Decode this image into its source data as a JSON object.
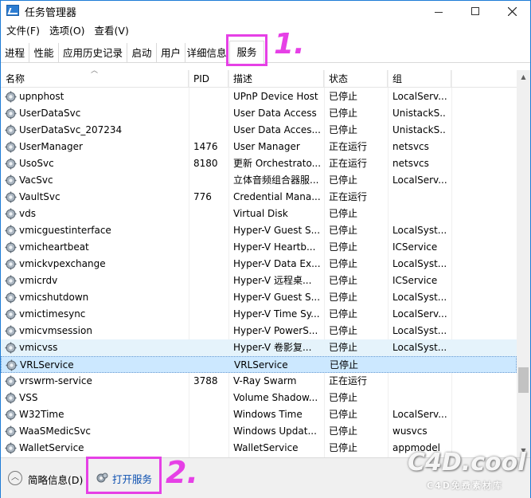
{
  "window": {
    "title": "任务管理器"
  },
  "menu": [
    "文件(F)",
    "选项(O)",
    "查看(V)"
  ],
  "tabs": [
    "进程",
    "性能",
    "应用历史记录",
    "启动",
    "用户",
    "详细信息",
    "服务"
  ],
  "active_tab": "服务",
  "annotations": {
    "step1": "1.",
    "step2": "2."
  },
  "columns": {
    "name": "名称",
    "pid": "PID",
    "desc": "描述",
    "state": "状态",
    "group": "组"
  },
  "rows": [
    {
      "name": "upnphost",
      "pid": "",
      "desc": "UPnP Device Host",
      "state": "已停止",
      "group": "LocalServ..."
    },
    {
      "name": "UserDataSvc",
      "pid": "",
      "desc": "User Data Access",
      "state": "已停止",
      "group": "UnistackS..."
    },
    {
      "name": "UserDataSvc_207234",
      "pid": "",
      "desc": "User Data Acces...",
      "state": "已停止",
      "group": "UnistackS..."
    },
    {
      "name": "UserManager",
      "pid": "1476",
      "desc": "User Manager",
      "state": "正在运行",
      "group": "netsvcs"
    },
    {
      "name": "UsoSvc",
      "pid": "8180",
      "desc": "更新 Orchestrato...",
      "state": "正在运行",
      "group": "netsvcs"
    },
    {
      "name": "VacSvc",
      "pid": "",
      "desc": "立体音频组合器服...",
      "state": "已停止",
      "group": "LocalServ..."
    },
    {
      "name": "VaultSvc",
      "pid": "776",
      "desc": "Credential Mana...",
      "state": "正在运行",
      "group": ""
    },
    {
      "name": "vds",
      "pid": "",
      "desc": "Virtual Disk",
      "state": "已停止",
      "group": ""
    },
    {
      "name": "vmicguestinterface",
      "pid": "",
      "desc": "Hyper-V Guest S...",
      "state": "已停止",
      "group": "LocalSyst..."
    },
    {
      "name": "vmicheartbeat",
      "pid": "",
      "desc": "Hyper-V Heartb...",
      "state": "已停止",
      "group": "ICService"
    },
    {
      "name": "vmickvpexchange",
      "pid": "",
      "desc": "Hyper-V Data Ex...",
      "state": "已停止",
      "group": "LocalSyst..."
    },
    {
      "name": "vmicrdv",
      "pid": "",
      "desc": "Hyper-V 远程桌...",
      "state": "已停止",
      "group": "ICService"
    },
    {
      "name": "vmicshutdown",
      "pid": "",
      "desc": "Hyper-V Guest S...",
      "state": "已停止",
      "group": "LocalSyst..."
    },
    {
      "name": "vmictimesync",
      "pid": "",
      "desc": "Hyper-V Time Sy...",
      "state": "已停止",
      "group": "LocalServ..."
    },
    {
      "name": "vmicvmsession",
      "pid": "",
      "desc": "Hyper-V PowerS...",
      "state": "已停止",
      "group": "LocalSyst..."
    },
    {
      "name": "vmicvss",
      "pid": "",
      "desc": "Hyper-V 卷影复...",
      "state": "已停止",
      "group": "LocalSyst..."
    },
    {
      "name": "VRLService",
      "pid": "",
      "desc": "VRLService",
      "state": "已停止",
      "group": ""
    },
    {
      "name": "vrswrm-service",
      "pid": "3788",
      "desc": "V-Ray Swarm",
      "state": "正在运行",
      "group": ""
    },
    {
      "name": "VSS",
      "pid": "",
      "desc": "Volume Shadow...",
      "state": "已停止",
      "group": ""
    },
    {
      "name": "W32Time",
      "pid": "",
      "desc": "Windows Time",
      "state": "已停止",
      "group": "LocalServ..."
    },
    {
      "name": "WaaSMedicSvc",
      "pid": "",
      "desc": "Windows Updat...",
      "state": "已停止",
      "group": "wusvcs"
    },
    {
      "name": "WalletService",
      "pid": "",
      "desc": "WalletService",
      "state": "已停止",
      "group": "appmodel"
    }
  ],
  "hover_row": "vmicvss",
  "selected_row": "VRLService",
  "footer": {
    "brief_label": "简略信息(D)",
    "open_services": "打开服务"
  },
  "watermark": {
    "logo": "C4D.cool",
    "sub": "C4D免费素材库"
  },
  "colors": {
    "annotation": "#e640e6",
    "selected_bg": "#cce8ff",
    "hover_bg": "#e5f3fb",
    "link": "#0b4fb0"
  }
}
